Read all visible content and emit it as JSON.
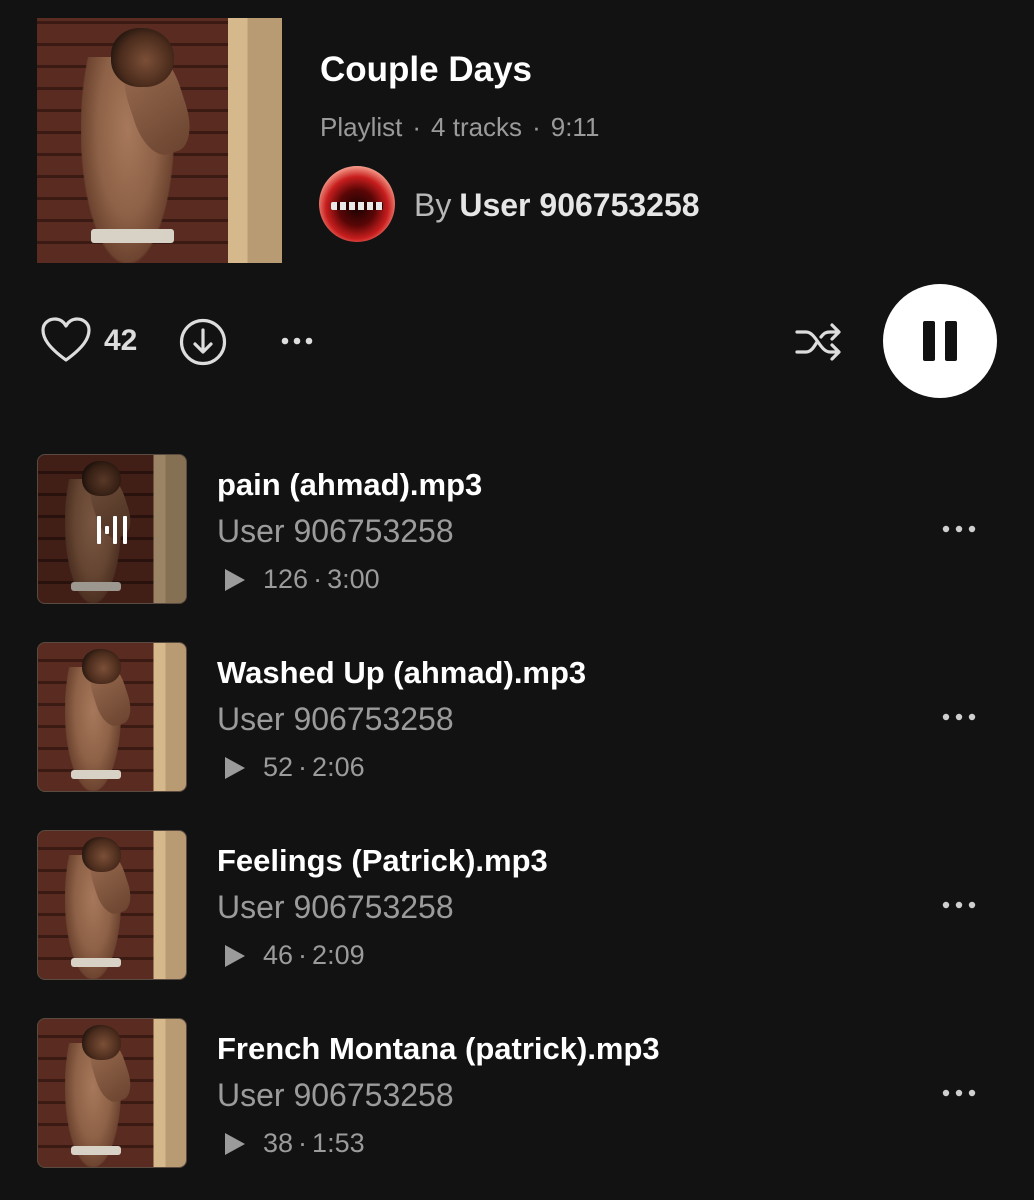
{
  "playlist": {
    "title": "Couple Days",
    "type": "Playlist",
    "tracks_count": "4 tracks",
    "duration": "9:11",
    "owner_prefix": "By",
    "owner_name": "User 906753258"
  },
  "actions": {
    "like_count": "42",
    "like_icon": "heart-outline",
    "download_icon": "download-circle",
    "more_icon": "ellipsis",
    "shuffle_icon": "shuffle",
    "play_state": "playing",
    "play_button_color": "#ffffff"
  },
  "separator": "·",
  "tracks": [
    {
      "title": "pain (ahmad).mp3",
      "artist": "User 906753258",
      "plays": "126",
      "duration": "3:00",
      "now_playing": true
    },
    {
      "title": "Washed Up (ahmad).mp3",
      "artist": "User 906753258",
      "plays": "52",
      "duration": "2:06",
      "now_playing": false
    },
    {
      "title": "Feelings (Patrick).mp3",
      "artist": "User 906753258",
      "plays": "46",
      "duration": "2:09",
      "now_playing": false
    },
    {
      "title": "French Montana (patrick).mp3",
      "artist": "User 906753258",
      "plays": "38",
      "duration": "1:53",
      "now_playing": false
    }
  ],
  "colors": {
    "background": "#121212",
    "primary_text": "#ffffff",
    "secondary_text": "#9b9b9b"
  }
}
